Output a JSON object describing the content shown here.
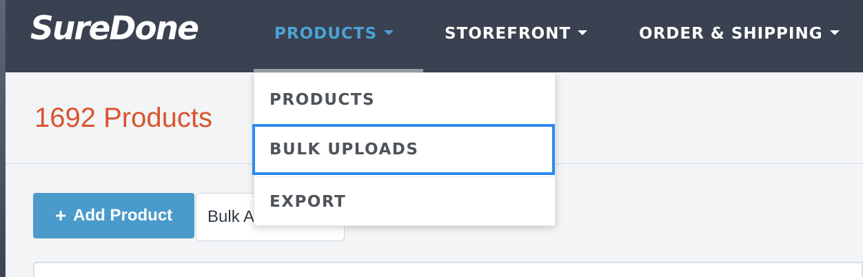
{
  "header": {
    "logo": "SureDone",
    "nav": [
      {
        "label": "PRODUCTS",
        "active": true
      },
      {
        "label": "STOREFRONT",
        "active": false
      },
      {
        "label": "ORDER & SHIPPING",
        "active": false
      }
    ]
  },
  "dropdown": {
    "items": [
      {
        "label": "PRODUCTS"
      },
      {
        "label": "BULK UPLOADS",
        "highlighted": true
      },
      {
        "label": "EXPORT"
      }
    ]
  },
  "main": {
    "title": "1692 Products",
    "add_product_label": "Add Product",
    "bulk_actions_label": "Bulk A"
  },
  "colors": {
    "navbar": "#3a4150",
    "active_nav": "#4ba3d6",
    "title": "#d9532c",
    "primary_button": "#4a9bcb",
    "highlight_border": "#2a8af0"
  },
  "icons": {
    "caret": "caret-down-icon",
    "plus": "plus-icon"
  }
}
